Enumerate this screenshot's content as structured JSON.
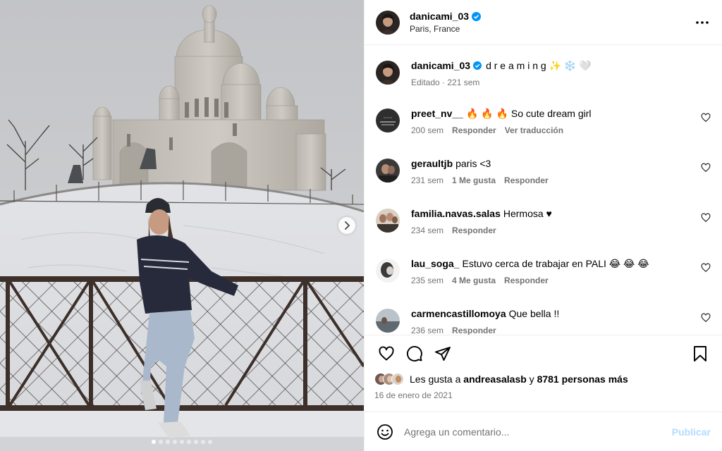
{
  "header": {
    "username": "danicami_03",
    "location": "Paris, France"
  },
  "caption": {
    "username": "danicami_03",
    "text": "d r e a m i n g ✨ ❄️ 🤍",
    "meta": "Editado · 221 sem"
  },
  "comments": [
    {
      "username": "preet_nv__",
      "text": "🔥 🔥 🔥 So cute dream girl",
      "age": "200 sem",
      "likes": "",
      "reply": "Responder",
      "translate": "Ver traducción"
    },
    {
      "username": "geraultjb",
      "text": "paris <3",
      "age": "231 sem",
      "likes": "1 Me gusta",
      "reply": "Responder",
      "translate": ""
    },
    {
      "username": "familia.navas.salas",
      "text": "Hermosa ♥",
      "age": "234 sem",
      "likes": "",
      "reply": "Responder",
      "translate": ""
    },
    {
      "username": "lau_soga_",
      "text": "Estuvo cerca de trabajar en PALI 😂 😂 😂",
      "age": "235 sem",
      "likes": "4 Me gusta",
      "reply": "Responder",
      "translate": ""
    },
    {
      "username": "carmencastillomoya",
      "text": "Que bella !!",
      "age": "236 sem",
      "likes": "",
      "reply": "Responder",
      "translate": ""
    }
  ],
  "likes": {
    "prefix": "Les gusta a",
    "user": "andreasalasb",
    "connector": "y",
    "others": "8781 personas más"
  },
  "date": "16 de enero de 2021",
  "composer": {
    "placeholder": "Agrega un comentario...",
    "publish": "Publicar"
  },
  "carousel": {
    "slides": 9,
    "active": 0
  },
  "colors": {
    "verified": "#0095f6",
    "publish_disabled": "#b3dbff",
    "meta_gray": "#737373"
  }
}
